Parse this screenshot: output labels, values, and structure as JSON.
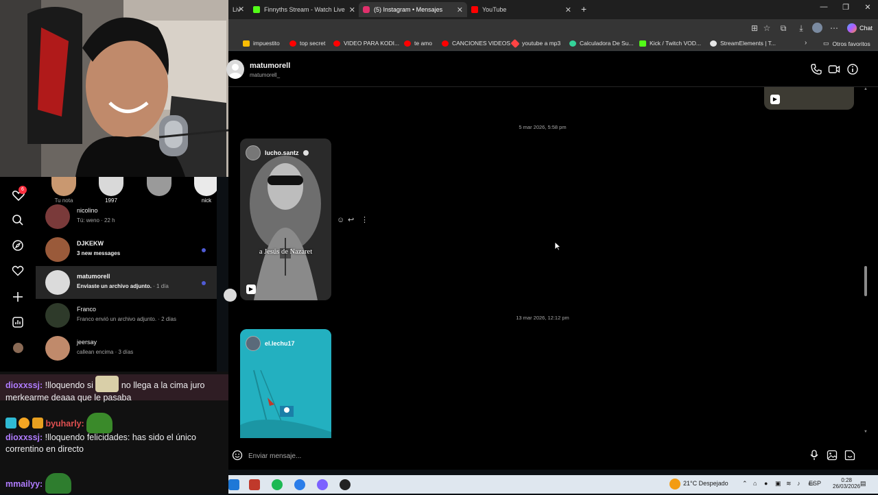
{
  "browser": {
    "tabs": [
      {
        "label": "Liv",
        "favicon_color": "#9146ff"
      },
      {
        "label": "Finnyths Stream - Watch Live",
        "favicon_color": "#53fc18"
      },
      {
        "label": "(5) Instagram • Mensajes",
        "favicon_color": "#e1306c"
      },
      {
        "label": "YouTube",
        "favicon_color": "#ff0000"
      }
    ],
    "new_tab_icon": "plus-icon",
    "chat_label": "Chat",
    "bookmarks": [
      {
        "label": "impuestito",
        "color": "#fbbc04"
      },
      {
        "label": "top secret",
        "color": "#ff0000"
      },
      {
        "label": "VIDEO PARA KODI...",
        "color": "#ff0000"
      },
      {
        "label": "te amo",
        "color": "#ff0000"
      },
      {
        "label": "CANCIONES VIDEOS",
        "color": "#ff0000"
      },
      {
        "label": "youtube a mp3",
        "color": "#ff4444"
      },
      {
        "label": "Calculadora De Su...",
        "color": "#34d399"
      },
      {
        "label": "Kick / Twitch VOD...",
        "color": "#53fc18"
      },
      {
        "label": "StreamElements | T...",
        "color": "#e5e5e5"
      }
    ],
    "other_bookmarks": "Otros favoritos"
  },
  "dm": {
    "name": "matumorell",
    "username": "matumorell_",
    "messages": [
      {
        "timestamp": "5 mar 2026, 5:58 pm",
        "reel_user": "lucho.santz",
        "caption": "a Jesús de Nazaret"
      },
      {
        "timestamp": "13 mar 2026, 12:12 pm",
        "reel_user": "el.lechu17"
      }
    ],
    "input_placeholder": "Enviar mensaje..."
  },
  "sidebar": {
    "notification_count": "6"
  },
  "notes": [
    {
      "label": "Tu nota"
    },
    {
      "label": "1997"
    },
    {
      "label": ""
    },
    {
      "label": "nick"
    }
  ],
  "conversations": [
    {
      "name": "nicolino",
      "preview": "Tú: weno · 22 h",
      "unread": false,
      "selected": false
    },
    {
      "name": "DJKEKW",
      "preview": "3 new messages",
      "unread": true,
      "selected": false
    },
    {
      "name": "matumorell",
      "preview": "Enviaste un archivo adjunto.",
      "time": " · 1 día",
      "unread": true,
      "selected": true
    },
    {
      "name": "Franco",
      "preview": "Franco envió un archivo adjunto. · 2 días",
      "unread": false,
      "selected": false
    },
    {
      "name": "jeersay",
      "preview": "callean encima · 3 días",
      "unread": false,
      "selected": false
    }
  ],
  "chat": [
    {
      "user": "dioxxssj:",
      "text": "!lloquendo si",
      "text2": "no llega a la cima juro merkearme deaaa que le pasaba"
    },
    {
      "user": "byuharly:",
      "text": ""
    },
    {
      "user": "dioxxssj:",
      "text": "!lloquendo felicidades: has sido el único correntino en directo"
    },
    {
      "user": "mmailyy:",
      "text": ""
    }
  ],
  "taskbar": {
    "weather": "21°C Despejado",
    "language": "ESP",
    "time": "0:28",
    "date": "26/03/2026"
  }
}
